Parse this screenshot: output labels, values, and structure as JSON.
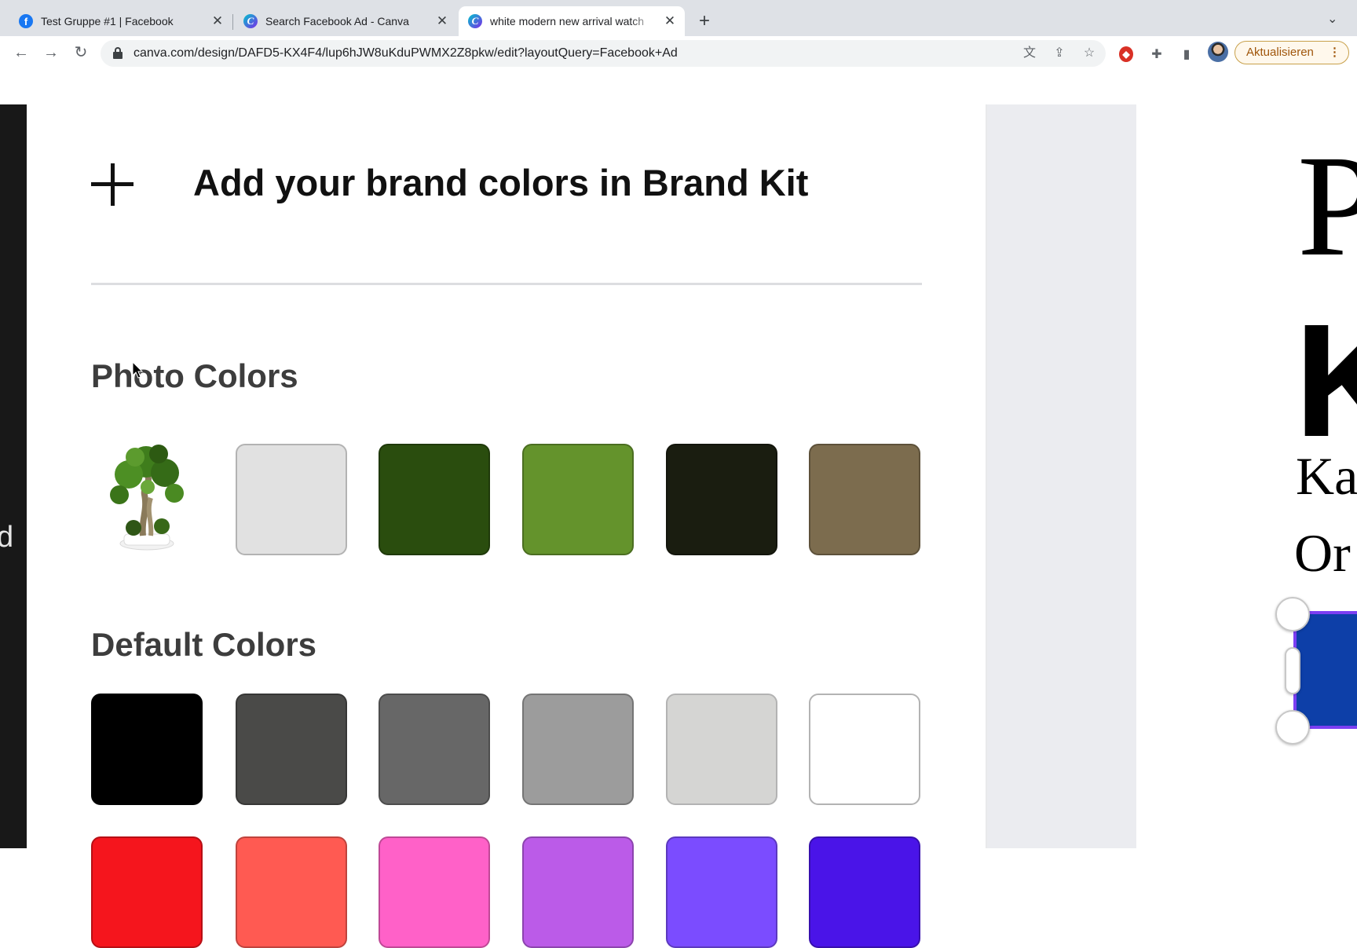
{
  "browser": {
    "tabs": [
      {
        "title": "Test Gruppe #1 | Facebook",
        "icon": "facebook-icon",
        "active": false
      },
      {
        "title": "Search Facebook Ad - Canva",
        "icon": "canva-icon",
        "active": false
      },
      {
        "title": "white modern new arrival watch",
        "icon": "canva-icon",
        "active": true
      }
    ],
    "new_tab_label": "+",
    "url": "canva.com/design/DAFD5-KX4F4/lup6hJW8uKduPWMX2Z8pkw/edit?layoutQuery=Facebook+Ad",
    "update_label": "Aktualisieren"
  },
  "panel": {
    "brand_kit_label": "Add your brand colors in Brand Kit",
    "photo_colors_title": "Photo Colors",
    "default_colors_title": "Default Colors",
    "photo_colors": [
      "#e1e1e1",
      "#2a4d0e",
      "#64932c",
      "#1a1d10",
      "#7c6c4e"
    ],
    "default_colors_row1": [
      "#000000",
      "#4a4a48",
      "#676767",
      "#9c9c9c",
      "#d5d5d3",
      "#ffffff"
    ],
    "default_colors_row2": [
      "#f5151d",
      "#ff5a52",
      "#ff61c8",
      "#bb5be8",
      "#7b4cff",
      "#4a14e8"
    ]
  },
  "side_letter": "d",
  "design_preview": {
    "line1": "P",
    "line2": "K",
    "line3": "Ka",
    "line4": "Or"
  },
  "colors": {
    "selection": "#7b3ff2",
    "selected_fill": "#0d3fa8",
    "update_accent": "#a0560b"
  }
}
